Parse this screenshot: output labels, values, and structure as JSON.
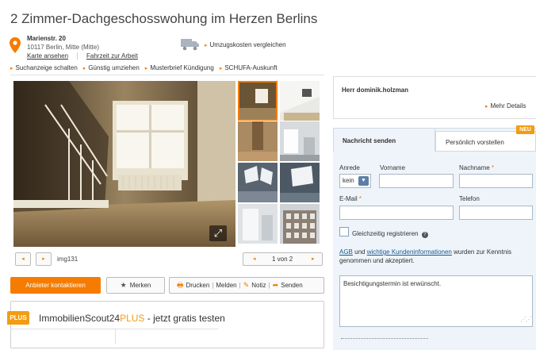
{
  "listing": {
    "title": "2 Zimmer-Dachgeschosswohung im Herzen Berlins",
    "street": "Marienstr. 20",
    "city": "10117 Berlin, Mitte (Mitte)",
    "map_link": "Karte ansehen",
    "route_link": "Fahrzeit zur Arbeit",
    "moving_costs_link": "Umzugskosten vergleichen"
  },
  "top_links": [
    "Suchanzeige schalten",
    "Günstig umziehen",
    "Musterbrief Kündigung",
    "SCHUFA-Auskunft"
  ],
  "gallery": {
    "image_name": "img131",
    "pager": "1 von 2",
    "thumbnail_count": 8
  },
  "actions": {
    "contact": "Anbieter kontaktieren",
    "remember": "Merken",
    "print": "Drucken",
    "report": "Melden",
    "note": "Notiz",
    "send": "Senden"
  },
  "promo": {
    "badge": "PLUS",
    "brand": "ImmobilienScout24",
    "plus": "PLUS",
    "tagline": " - jetzt gratis testen"
  },
  "agent": {
    "name": "Herr dominik.holzman",
    "details": "Mehr Details"
  },
  "form": {
    "tab_send": "Nachricht senden",
    "tab_introduce": "Persönlich vorstellen",
    "new_badge": "NEU",
    "salutation_label": "Anrede",
    "salutation_value": "kein",
    "firstname_label": "Vorname",
    "lastname_label": "Nachname",
    "email_label": "E-Mail",
    "phone_label": "Telefon",
    "required_mark": "*",
    "register_label": "Gleichzeitig registrieren",
    "agb_link": "AGB",
    "agb_and": " und ",
    "info_link": "wichtige Kundeninformationen",
    "agb_rest": " wurden zur Kenntnis genommen und akzeptiert.",
    "message": "Besichtigungstermin ist erwünscht."
  },
  "colors": {
    "accent": "#f57c00",
    "plus": "#f39c12",
    "form_bg": "#eef4fa"
  }
}
